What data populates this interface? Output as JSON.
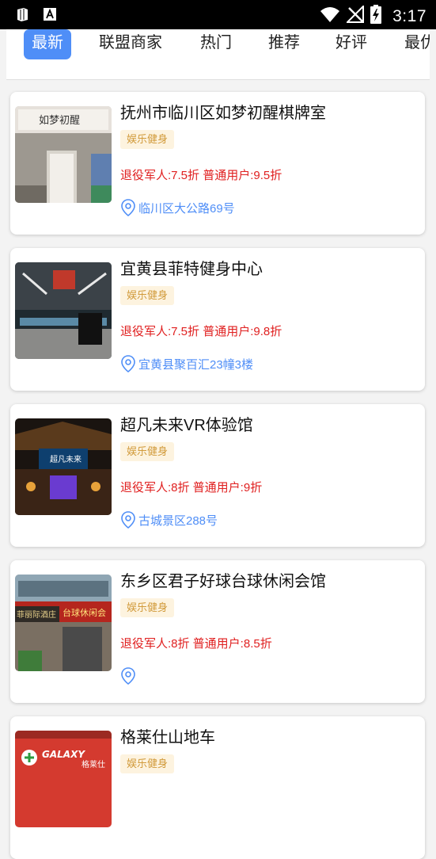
{
  "status_bar": {
    "time": "3:17",
    "icons": [
      "sim-card-icon",
      "font-download-icon",
      "wifi-icon",
      "no-signal-icon",
      "battery-charging-icon"
    ]
  },
  "tabs": [
    {
      "label": "最新",
      "active": true
    },
    {
      "label": "联盟商家",
      "active": false
    },
    {
      "label": "热门",
      "active": false
    },
    {
      "label": "推荐",
      "active": false
    },
    {
      "label": "好评",
      "active": false
    },
    {
      "label": "最优",
      "active": false
    }
  ],
  "merchants": [
    {
      "title": "抚州市临川区如梦初醒棋牌室",
      "tag": "娱乐健身",
      "discount": "退役军人:7.5折 普通用户:9.5折",
      "address": "临川区大公路69号",
      "thumb_icon": "storefront-photo"
    },
    {
      "title": "宜黄县菲特健身中心",
      "tag": "娱乐健身",
      "discount": "退役军人:7.5折 普通用户:9.8折",
      "address": "宜黄县聚百汇23幢3楼",
      "thumb_icon": "gym-photo"
    },
    {
      "title": "超凡未来VR体验馆",
      "tag": "娱乐健身",
      "discount": "退役军人:8折 普通用户:9折",
      "address": "古城景区288号",
      "thumb_icon": "vr-hall-photo"
    },
    {
      "title": "东乡区君子好球台球休闲会馆",
      "tag": "娱乐健身",
      "discount": "退役军人:8折 普通用户:8.5折",
      "address": "",
      "thumb_icon": "billiards-photo"
    },
    {
      "title": "格莱仕山地车",
      "tag": "娱乐健身",
      "discount": "",
      "address": "",
      "thumb_icon": "bike-shop-photo"
    }
  ],
  "photo_text": {
    "store_sign": "如梦初醒",
    "vr_sign": "超凡未来",
    "billiards_sign_1": "台球休闲会",
    "billiards_sign_2": "菲丽际酒庄",
    "bike_brand": "GALAXY",
    "bike_brand_cn": "格莱仕"
  },
  "colors": {
    "accent": "#4f8ef7",
    "discount": "#e02020",
    "tag_bg": "#fdf3df",
    "tag_text": "#d19a3a"
  }
}
